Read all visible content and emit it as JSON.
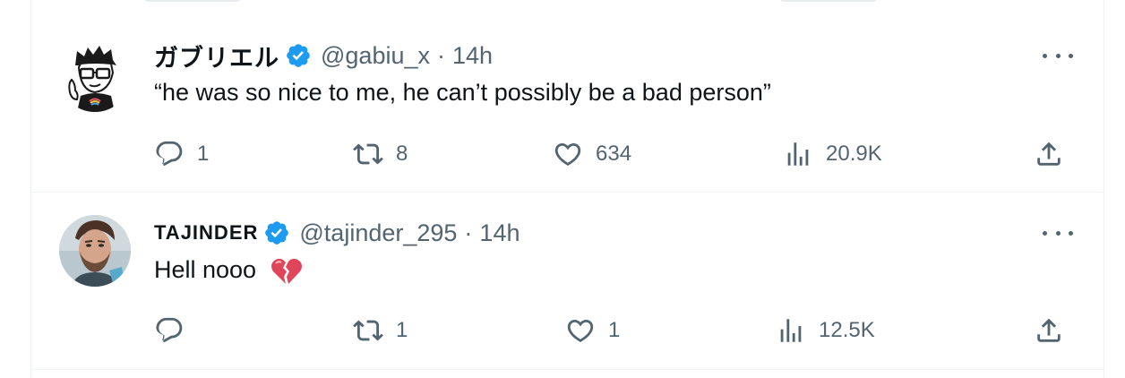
{
  "tweets": [
    {
      "display_name": "ガブリエル",
      "handle": "@gabiu_x",
      "separator": "·",
      "time": "14h",
      "text": "“he was so nice to me, he can’t possibly be a bad person”",
      "replies": "1",
      "retweets": "8",
      "likes": "634",
      "views": "20.9K"
    },
    {
      "display_name": "TAJINDER",
      "handle": "@tajinder_295",
      "separator": "·",
      "time": "14h",
      "text": "Hell nooo",
      "emoji": "broken-heart-icon",
      "replies": "",
      "retweets": "1",
      "likes": "1",
      "views": "12.5K"
    }
  ],
  "colors": {
    "verified": "#1d9bf0",
    "muted": "#536471",
    "text": "#0f1419",
    "divider": "#eff3f4",
    "broken_heart": "#e0455a"
  }
}
